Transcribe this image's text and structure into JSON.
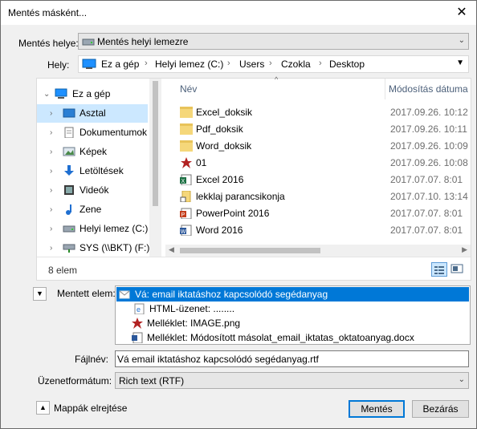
{
  "title": "Mentés másként...",
  "save_location": {
    "label": "Mentés helye:",
    "value": "Mentés helyi lemezre"
  },
  "location": {
    "label": "Hely:",
    "crumbs": [
      "Ez a gép",
      "Helyi lemez (C:)",
      "Users",
      "Czokla",
      "Desktop"
    ]
  },
  "tree": [
    {
      "label": "Ez a gép",
      "icon": "computer-icon"
    },
    {
      "label": "Asztal",
      "icon": "desktop-icon"
    },
    {
      "label": "Dokumentumok",
      "icon": "documents-icon"
    },
    {
      "label": "Képek",
      "icon": "pictures-icon"
    },
    {
      "label": "Letöltések",
      "icon": "downloads-icon"
    },
    {
      "label": "Videók",
      "icon": "videos-icon"
    },
    {
      "label": "Zene",
      "icon": "music-icon"
    },
    {
      "label": "Helyi lemez (C:)",
      "icon": "drive-icon"
    },
    {
      "label": "SYS (\\\\BKT) (F:)",
      "icon": "network-drive-icon"
    }
  ],
  "columns": {
    "name": "Név",
    "modified": "Módosítás dátuma"
  },
  "files": [
    {
      "name": "Excel_doksik",
      "date": "2017.09.26. 10:12",
      "icon": "folder-icon"
    },
    {
      "name": "Pdf_doksik",
      "date": "2017.09.26. 10:11",
      "icon": "folder-icon"
    },
    {
      "name": "Word_doksik",
      "date": "2017.09.26. 10:09",
      "icon": "folder-icon"
    },
    {
      "name": "01",
      "date": "2017.09.26. 10:08",
      "icon": "image-file-icon"
    },
    {
      "name": "Excel 2016",
      "date": "2017.07.07. 8:01",
      "icon": "excel-icon"
    },
    {
      "name": "lekklaj parancsikonja",
      "date": "2017.07.10. 13:14",
      "icon": "shortcut-icon"
    },
    {
      "name": "PowerPoint 2016",
      "date": "2017.07.07. 8:01",
      "icon": "powerpoint-icon"
    },
    {
      "name": "Word 2016",
      "date": "2017.07.07. 8:01",
      "icon": "word-icon"
    }
  ],
  "item_count": "8 elem",
  "saved_item": {
    "label": "Mentett elem:",
    "items": [
      {
        "text": "Vá: email iktatáshoz kapcsolódó segédanyag",
        "icon": "mail-icon"
      },
      {
        "text": "HTML-üzenet: ........",
        "icon": "html-icon"
      },
      {
        "text": "Melléklet: IMAGE.png",
        "icon": "image-file-icon"
      },
      {
        "text": "Melléklet: Módosított másolat_email_iktatas_oktatoanyag.docx",
        "icon": "word-doc-icon"
      }
    ]
  },
  "filename": {
    "label": "Fájlnév:",
    "value": "Vá email iktatáshoz kapcsolódó segédanyag.rtf"
  },
  "format": {
    "label": "Üzenetformátum:",
    "value": "Rich text (RTF)"
  },
  "hide_folders": "Mappák elrejtése",
  "buttons": {
    "save": "Mentés",
    "close": "Bezárás"
  },
  "colors": {
    "accent": "#0078d7",
    "selection": "#cce8ff"
  }
}
